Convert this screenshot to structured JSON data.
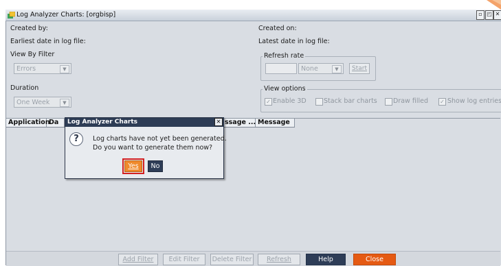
{
  "window": {
    "title": "Log Analyzer Charts: [orgbisp]",
    "controls": [
      "restore",
      "maximize",
      "close"
    ]
  },
  "header": {
    "created_by_label": "Created by:",
    "created_on_label": "Created on:",
    "earliest_label": "Earliest date in log file:",
    "latest_label": "Latest date in log file:"
  },
  "filters": {
    "view_by_label": "View By Filter",
    "view_by_value": "Errors",
    "duration_label": "Duration",
    "duration_value": "One Week"
  },
  "refresh": {
    "legend": "Refresh rate",
    "input_value": "",
    "unit_value": "None",
    "start_label": "Start"
  },
  "view_options": {
    "legend": "View options",
    "enable_3d": {
      "label": "Enable 3D",
      "checked": true
    },
    "stack_bar": {
      "label": "Stack bar charts",
      "checked": false
    },
    "draw_filled": {
      "label": "Draw filled",
      "checked": false
    },
    "show_log": {
      "label": "Show log entries",
      "checked": true
    }
  },
  "table": {
    "columns": [
      "Application",
      "Da",
      "ssage ...",
      "Message"
    ]
  },
  "dialog": {
    "title": "Log Analyzer Charts",
    "line1": "Log charts have not yet been generated.",
    "line2": "Do you want to generate them now?",
    "yes_label": "Yes",
    "no_label": "No",
    "icon": "question-icon"
  },
  "footer": {
    "add_filter": "Add Filter",
    "edit_filter": "Edit Filter",
    "delete_filter": "Delete Filter",
    "refresh": "Refresh",
    "help": "Help",
    "close": "Close"
  },
  "colors": {
    "accent_orange": "#e55a13",
    "dialog_title": "#2d3c55",
    "highlight_red": "#d32020"
  }
}
